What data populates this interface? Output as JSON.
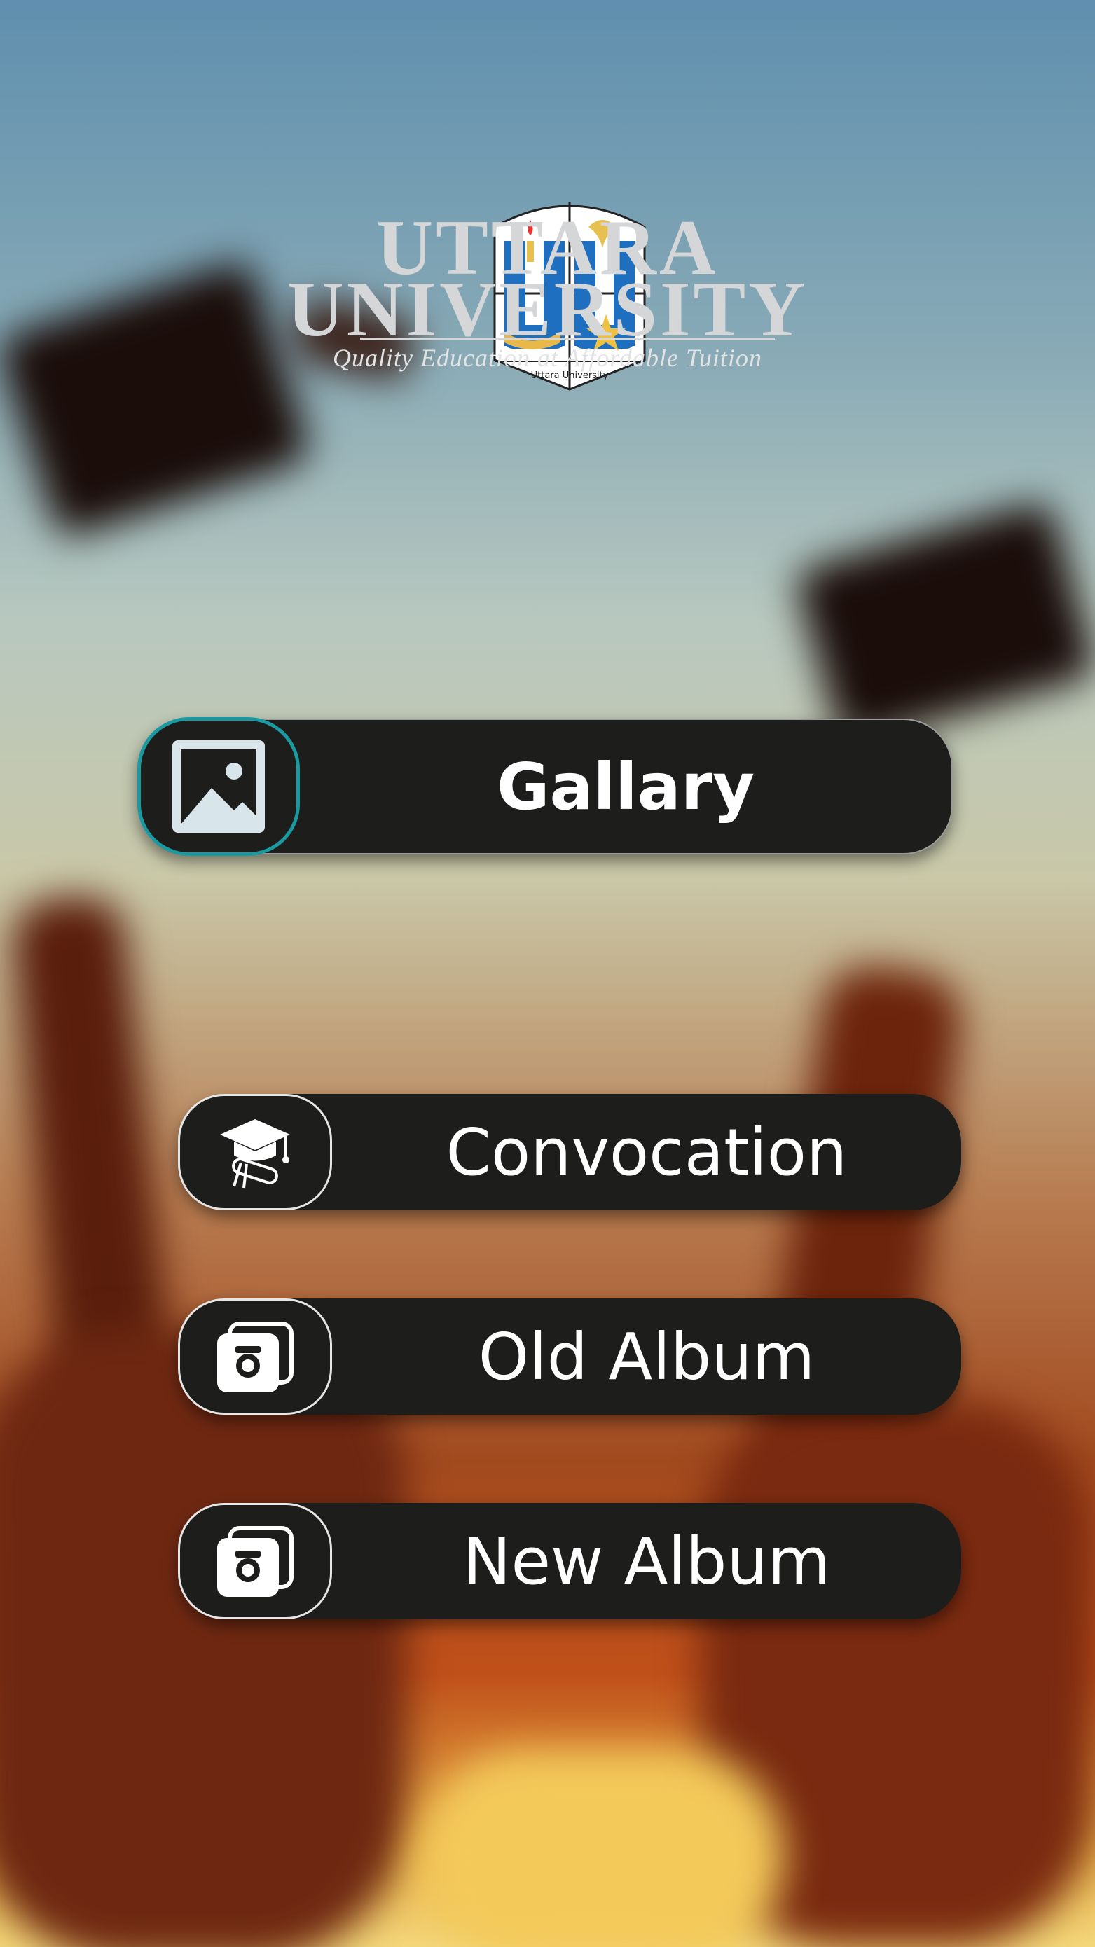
{
  "app": {
    "university_name_line1": "UTTARA",
    "university_name_line2": "UNIVERSITY",
    "tagline": "Quality Education at Affordable Tuition",
    "seal_text": "Uttara University"
  },
  "menu": {
    "gallery": {
      "label": "Gallary",
      "icon": "image-icon"
    },
    "convocation": {
      "label": "Convocation",
      "icon": "graduation-cap-icon"
    },
    "old_album": {
      "label": "Old Album",
      "icon": "camera-album-icon"
    },
    "new_album": {
      "label": "New Album",
      "icon": "camera-album-icon"
    }
  },
  "colors": {
    "button_bg": "#1d1d1b",
    "gallery_icon_ring": "#1a9aa0",
    "logo_blue": "#1f6fc0",
    "logo_text": "#d4d6d8"
  }
}
